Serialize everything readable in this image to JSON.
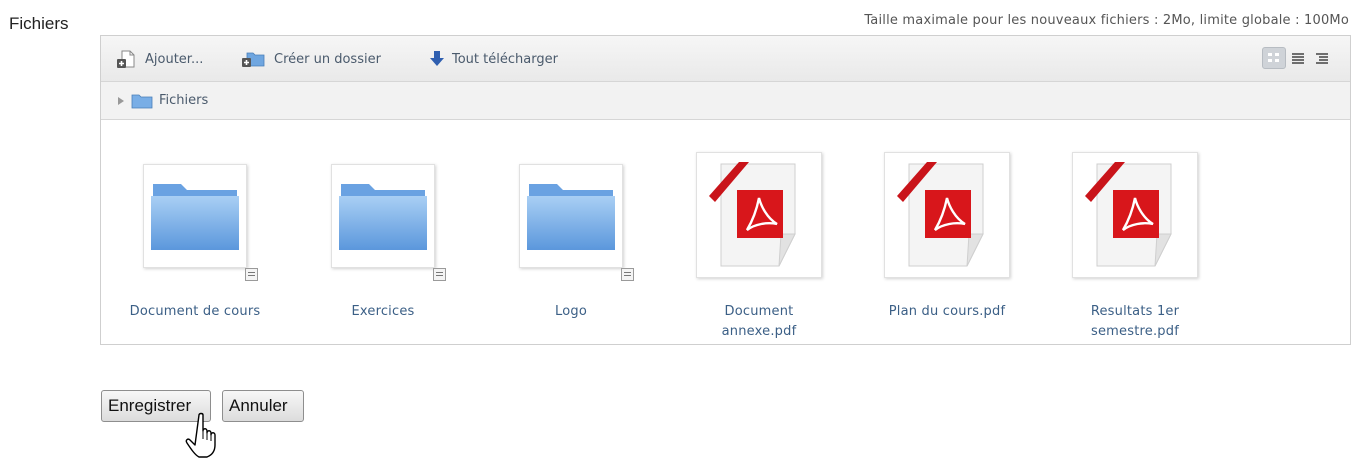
{
  "field": {
    "label": "Fichiers"
  },
  "limits": {
    "text": "Taille maximale pour les nouveaux fichiers : 2Mo, limite globale : 100Mo"
  },
  "toolbar": {
    "add_label": "Ajouter...",
    "mkdir_label": "Créer un dossier",
    "download_label": "Tout télécharger",
    "views": [
      {
        "icon": "icon-grid-icon",
        "active": true
      },
      {
        "icon": "list-icon",
        "active": false
      },
      {
        "icon": "tree-icon",
        "active": false
      }
    ]
  },
  "path": {
    "crumbs": [
      "Fichiers"
    ]
  },
  "items": [
    {
      "name": "Document de cours",
      "type": "folder"
    },
    {
      "name": "Exercices",
      "type": "folder"
    },
    {
      "name": "Logo",
      "type": "folder"
    },
    {
      "name": "Document annexe.pdf",
      "type": "pdf"
    },
    {
      "name": "Plan du cours.pdf",
      "type": "pdf"
    },
    {
      "name": "Resultats 1er semestre.pdf",
      "type": "pdf"
    }
  ],
  "actions": {
    "save_label": "Enregistrer",
    "cancel_label": "Annuler"
  },
  "colors": {
    "link": "#3b5f86",
    "folder": "#79aee6",
    "pdf_red": "#d8161b"
  }
}
